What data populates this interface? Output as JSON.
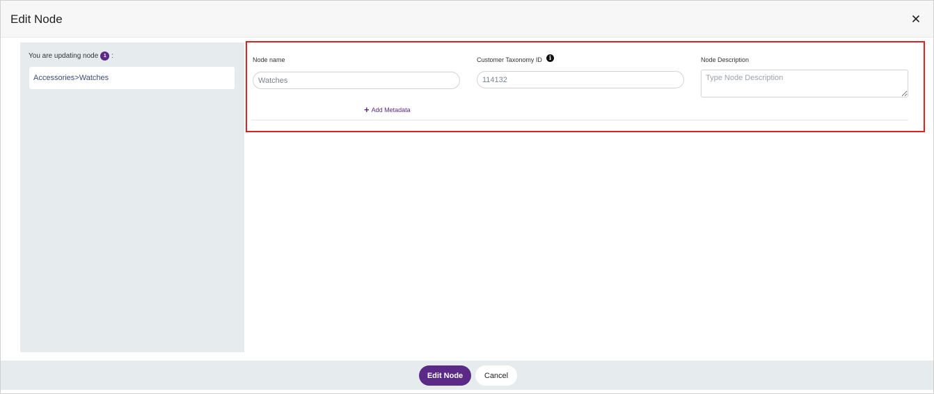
{
  "modal": {
    "title": "Edit Node"
  },
  "sidebar": {
    "updating_text": "You are updating node",
    "count": "1",
    "count_suffix": ":",
    "node_path": "Accessories>Watches"
  },
  "form": {
    "node_name_label": "Node name",
    "node_name_value": "Watches",
    "taxonomy_label": "Customer Taxonomy ID",
    "taxonomy_value": "114132",
    "description_label": "Node Description",
    "description_placeholder": "Type Node Description",
    "add_metadata_label": "Add Metadata"
  },
  "footer": {
    "primary_label": "Edit Node",
    "cancel_label": "Cancel"
  },
  "colors": {
    "accent": "#5b2a86",
    "highlight": "#e02020",
    "panel": "#e6ebee"
  },
  "icons": {
    "close": "close-icon",
    "info": "info-icon",
    "plus": "plus-icon"
  }
}
